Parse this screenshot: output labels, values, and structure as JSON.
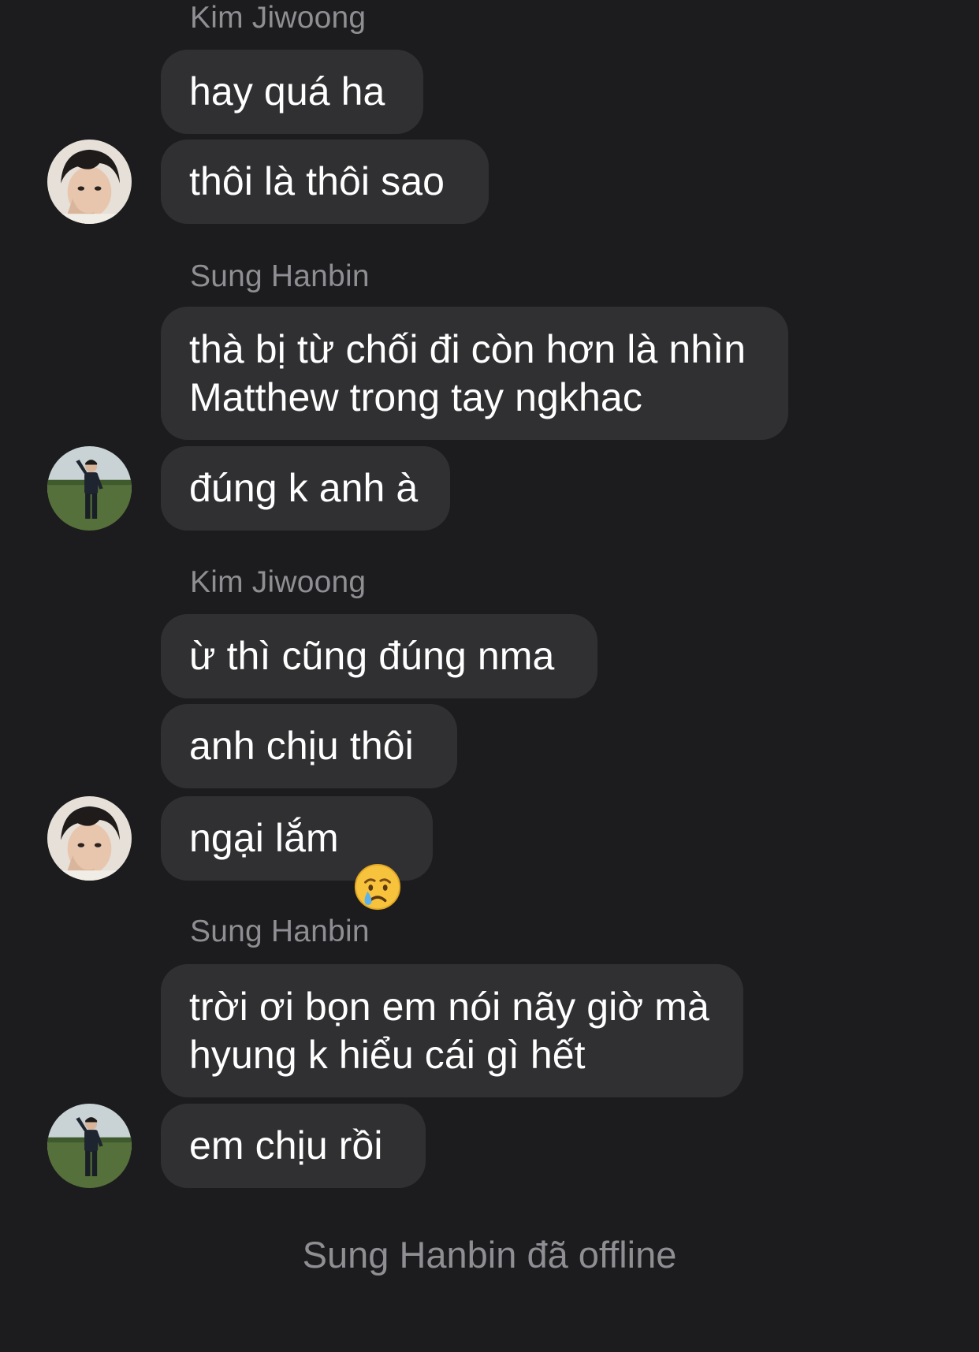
{
  "messages": {
    "g1": {
      "sender": "Kim Jiwoong",
      "m1": "hay quá ha",
      "m2": "thôi là thôi sao"
    },
    "g2": {
      "sender": "Sung Hanbin",
      "m1": "thà bị từ chối đi còn hơn là nhìn\nMatthew trong tay ngkhac",
      "m2": "đúng k anh à"
    },
    "g3": {
      "sender": "Kim Jiwoong",
      "m1": "ừ thì cũng đúng nma",
      "m2": "anh chịu thôi",
      "m3": "ngại lắm",
      "m3_emoji": "crying-face-emoji"
    },
    "g4": {
      "sender": "Sung Hanbin",
      "m1": "trời ơi bọn em nói nãy giờ mà\nhyung k hiểu cái gì hết",
      "m2": "em chịu rồi"
    }
  },
  "status": {
    "text": "Sung Hanbin đã offline"
  },
  "avatars": {
    "kim_jiwoong": "avatar-kim-jiwoong",
    "sung_hanbin": "avatar-sung-hanbin"
  },
  "colors": {
    "background": "#1c1c1e",
    "bubble": "#303033",
    "secondary_text": "#8e8e93",
    "message_text": "#ffffff"
  }
}
